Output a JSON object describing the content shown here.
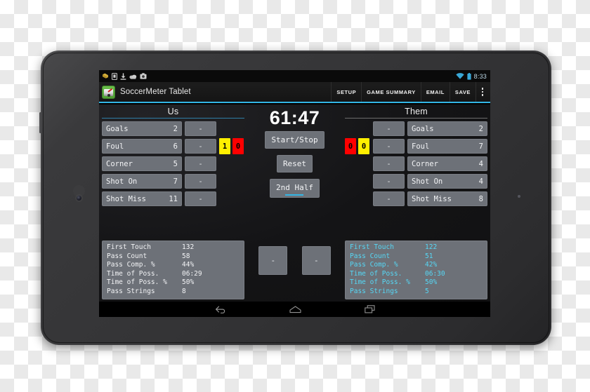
{
  "device": {
    "type": "android-tablet",
    "bezel_color": "#343436"
  },
  "statusbar": {
    "icons": [
      "bookmark-icon",
      "sim-card-icon",
      "download-icon",
      "cloud-icon",
      "screenshot-icon"
    ],
    "wifi_icon": "wifi-icon",
    "battery_icon": "battery-icon",
    "clock": "8:33",
    "accent": "#33b5e5"
  },
  "actionbar": {
    "app_icon": "soccermeter-gauge-icon",
    "title": "SoccerMeter Tablet",
    "actions": [
      {
        "label": "SETUP",
        "name": "setup"
      },
      {
        "label": "GAME SUMMARY",
        "name": "game-summary"
      },
      {
        "label": "EMAIL",
        "name": "email"
      },
      {
        "label": "SAVE",
        "name": "save"
      }
    ],
    "overflow_icon": "overflow-menu-icon",
    "accent": "#33b5e5"
  },
  "us": {
    "heading": "Us",
    "minus_label": "-",
    "rows": [
      {
        "label": "Goals",
        "value": "2"
      },
      {
        "label": "Foul",
        "value": "6"
      },
      {
        "label": "Corner",
        "value": "5"
      },
      {
        "label": "Shot On",
        "value": "7"
      },
      {
        "label": "Shot Miss",
        "value": "11"
      }
    ],
    "cards": {
      "yellow": "1",
      "red": "0",
      "yellow_color": "#ffef00",
      "red_color": "#ff0000"
    },
    "stats": [
      {
        "label": "First Touch",
        "value": "132"
      },
      {
        "label": "Pass Count",
        "value": "58"
      },
      {
        "label": "Pass Comp. %",
        "value": "44%"
      },
      {
        "label": "Time of Poss.",
        "value": "06:29"
      },
      {
        "label": "Time of Poss. %",
        "value": "50%"
      },
      {
        "label": "Pass Strings",
        "value": "8"
      }
    ]
  },
  "them": {
    "heading": "Them",
    "minus_label": "-",
    "rows": [
      {
        "label": "Goals",
        "value": "2"
      },
      {
        "label": "Foul",
        "value": "7"
      },
      {
        "label": "Corner",
        "value": "4"
      },
      {
        "label": "Shot On",
        "value": "4"
      },
      {
        "label": "Shot Miss",
        "value": "8"
      }
    ],
    "cards": {
      "red": "0",
      "yellow": "0",
      "yellow_color": "#ffef00",
      "red_color": "#ff0000"
    },
    "stats": [
      {
        "label": "First Touch",
        "value": "122"
      },
      {
        "label": "Pass Count",
        "value": "51"
      },
      {
        "label": "Pass Comp. %",
        "value": "42%"
      },
      {
        "label": "Time of Poss.",
        "value": "06:30"
      },
      {
        "label": "Time of Poss. %",
        "value": "50%"
      },
      {
        "label": "Pass Strings",
        "value": "5"
      }
    ],
    "text_color": "#56d7f5"
  },
  "center": {
    "clock": "61:47",
    "start_stop": "Start/Stop",
    "reset": "Reset",
    "half": "2nd Half",
    "half_selected_color": "#33b5e5",
    "minus_left": "-",
    "minus_right": "-"
  },
  "navbar": {
    "back_icon": "back-arrow-icon",
    "home_icon": "home-icon",
    "recents_icon": "recent-apps-icon"
  }
}
